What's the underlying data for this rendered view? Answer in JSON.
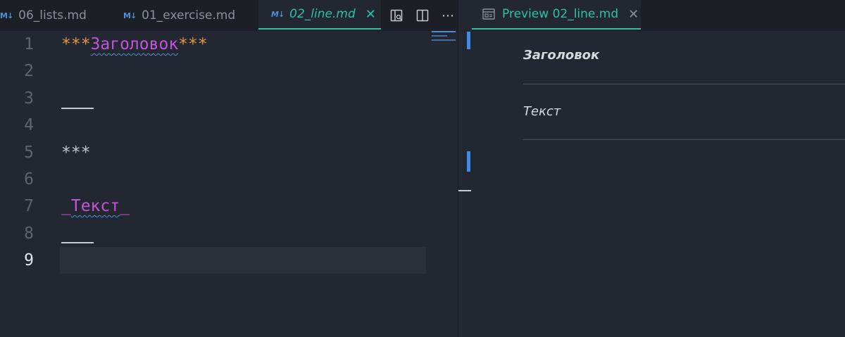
{
  "tabs": [
    {
      "label": "06_lists.md",
      "icon": "markdown-icon"
    },
    {
      "label": "01_exercise.md",
      "icon": "markdown-icon"
    },
    {
      "label": "02_line.md",
      "icon": "markdown-icon",
      "active": true,
      "close": "✕"
    }
  ],
  "toolbar": {
    "split_preview_icon": "open-preview-to-side-icon",
    "split_icon": "split-editor-icon",
    "more_icon": "⋯"
  },
  "preview_tab": {
    "label": "Preview 02_line.md",
    "close": "✕"
  },
  "editor": {
    "line_numbers": [
      "1",
      "2",
      "3",
      "4",
      "5",
      "6",
      "7",
      "8",
      "9"
    ],
    "current_line": "9",
    "line1": {
      "prefix": "***",
      "word": "Заголовок",
      "suffix": "***"
    },
    "line5": "***",
    "line7": {
      "prefix": "_",
      "word": "Текст",
      "suffix": "_"
    }
  },
  "preview": {
    "heading": "Заголовок",
    "text": "Текст"
  },
  "colors": {
    "accent": "#2fc0a6",
    "markdown_orange": "#e3963e",
    "emphasis_purple": "#c356d8",
    "background": "#232731"
  }
}
